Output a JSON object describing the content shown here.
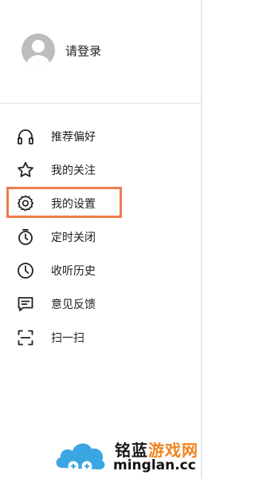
{
  "header": {
    "login_label": "请登录"
  },
  "menu": {
    "items": [
      {
        "label": "推荐偏好",
        "icon": "headphones-icon"
      },
      {
        "label": "我的关注",
        "icon": "star-icon"
      },
      {
        "label": "我的设置",
        "icon": "gear-icon"
      },
      {
        "label": "定时关闭",
        "icon": "timer-icon"
      },
      {
        "label": "收听历史",
        "icon": "clock-icon"
      },
      {
        "label": "意见反馈",
        "icon": "feedback-icon"
      },
      {
        "label": "扫一扫",
        "icon": "scan-icon"
      }
    ],
    "highlighted_item": "我的设置"
  },
  "watermark": {
    "cn_part1": "铭蓝",
    "cn_part2": "游戏网",
    "en": "minglan.cc"
  },
  "colors": {
    "highlight": "#ef7d4a",
    "text": "#1e1e1e",
    "avatar": "#bdbdbd"
  }
}
